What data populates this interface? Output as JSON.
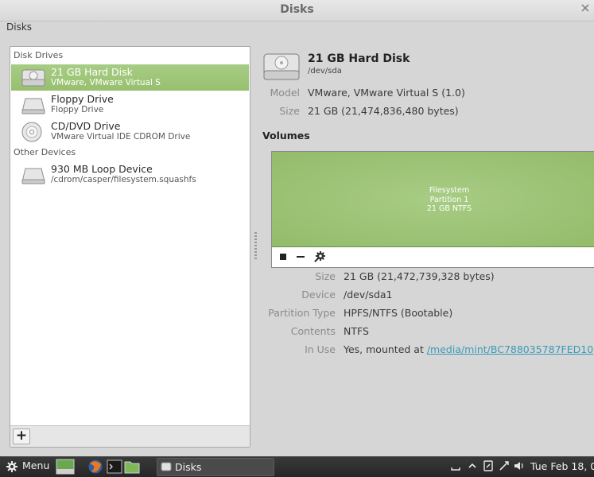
{
  "window": {
    "title": "Disks",
    "menu": "Disks"
  },
  "sidebar": {
    "disk_drives_header": "Disk Drives",
    "other_devices_header": "Other Devices",
    "drives": [
      {
        "name": "21 GB Hard Disk",
        "sub": "VMware, VMware Virtual S",
        "icon": "hard-disk-icon",
        "selected": true
      },
      {
        "name": "Floppy Drive",
        "sub": "Floppy Drive",
        "icon": "floppy-drive-icon"
      },
      {
        "name": "CD/DVD Drive",
        "sub": "VMware Virtual IDE CDROM Drive",
        "icon": "optical-drive-icon"
      }
    ],
    "devices": [
      {
        "name": "930 MB Loop Device",
        "sub": "/cdrom/casper/filesystem.squashfs",
        "icon": "loop-device-icon"
      }
    ],
    "add_label": "+"
  },
  "disk": {
    "title": "21 GB Hard Disk",
    "device": "/dev/sda",
    "model_label": "Model",
    "model": "VMware, VMware Virtual S (1.0)",
    "size_label": "Size",
    "size": "21 GB (21,474,836,480 bytes)"
  },
  "volumes": {
    "header": "Volumes",
    "partition": {
      "line1": "Filesystem",
      "line2": "Partition 1",
      "line3": "21 GB NTFS"
    },
    "details": [
      {
        "label": "Size",
        "value": "21 GB (21,472,739,328 bytes)"
      },
      {
        "label": "Device",
        "value": "/dev/sda1"
      },
      {
        "label": "Partition Type",
        "value": "HPFS/NTFS (Bootable)"
      },
      {
        "label": "Contents",
        "value": "NTFS"
      }
    ],
    "in_use_label": "In Use",
    "in_use_prefix": "Yes, mounted at ",
    "mount_point": "/media/mint/BC788035787FED10"
  },
  "taskbar": {
    "menu_label": "Menu",
    "window_label": "Disks",
    "clock": "Tue Feb 18, 0"
  },
  "colors": {
    "selection": "#9cc476",
    "link": "#3a9bb8",
    "taskbar": "#2e2e2e"
  }
}
